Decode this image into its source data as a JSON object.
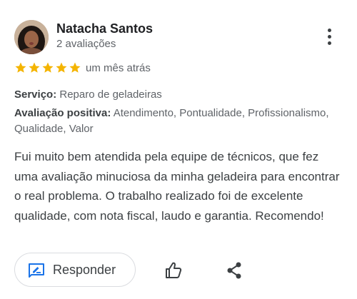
{
  "review": {
    "author_name": "Natacha Santos",
    "author_reviews": "2 avaliações",
    "rating": 5,
    "rating_max": 5,
    "star_color": "#f4b400",
    "time": "um mês atrás",
    "service_label": "Serviço:",
    "service_value": "Reparo de geladeiras",
    "positive_label": "Avaliação positiva:",
    "positive_value": "Atendimento, Pontualidade, Profissionalismo, Qualidade, Valor",
    "text": "Fui muito bem atendida pela equipe de técnicos, que fez uma avaliação minuciosa da minha geladeira para encontrar o real problema. O trabalho realizado foi de excelente qualidade, com nota fiscal, laudo e garantia. Recomendo!"
  },
  "actions": {
    "reply_label": "Responder",
    "reply_icon": "reply-edit-icon",
    "like_icon": "thumbs-up-icon",
    "share_icon": "share-icon",
    "more_icon": "more-vertical-icon",
    "accent_color": "#1a73e8"
  }
}
